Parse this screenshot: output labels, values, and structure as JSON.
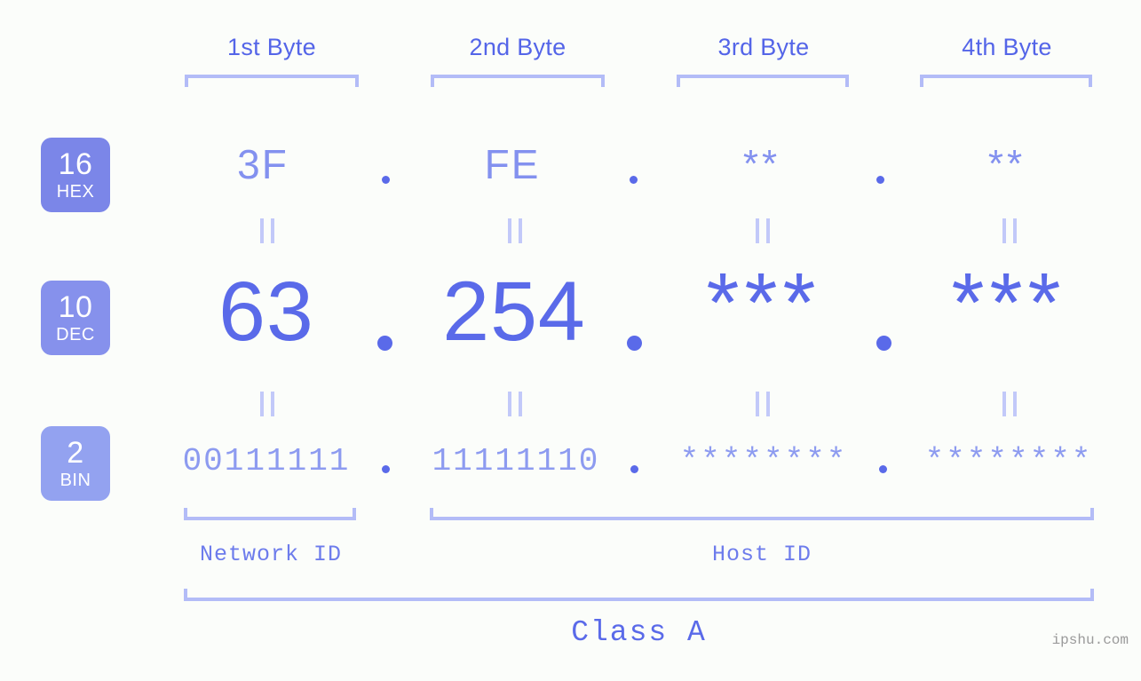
{
  "meta": {
    "background": "#fbfdfa",
    "accent": "#5a6ae9",
    "accent_light": "#b3bcf7",
    "watermark": "ipshu.com"
  },
  "byte_headers": [
    {
      "label": "1st Byte"
    },
    {
      "label": "2nd Byte"
    },
    {
      "label": "3rd Byte"
    },
    {
      "label": "4th Byte"
    }
  ],
  "bases": [
    {
      "number": "16",
      "name": "HEX",
      "color": "#7b86e8"
    },
    {
      "number": "10",
      "name": "DEC",
      "color": "#8691ec"
    },
    {
      "number": "2",
      "name": "BIN",
      "color": "#93a2f0"
    }
  ],
  "rows": {
    "hex": {
      "values": [
        "3F",
        "FE",
        "**",
        "**"
      ]
    },
    "dec": {
      "values": [
        "63",
        "254",
        "***",
        "***"
      ]
    },
    "bin": {
      "values": [
        "00111111",
        "11111110",
        "********",
        "********"
      ]
    }
  },
  "separators": {
    "dot": ".",
    "equals": "∥"
  },
  "segments": {
    "network_id": "Network ID",
    "host_id": "Host ID",
    "class": "Class A"
  }
}
